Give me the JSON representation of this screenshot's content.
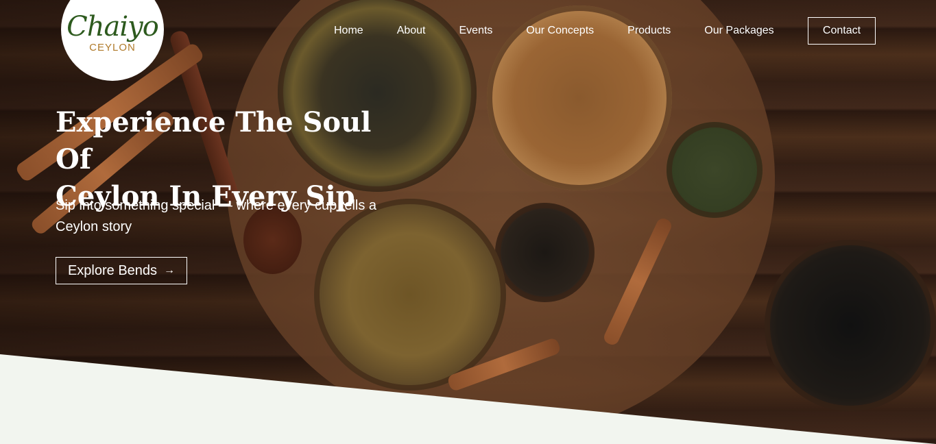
{
  "brand": {
    "logo_script": "Chaiyo",
    "logo_sub": "CEYLON"
  },
  "nav": {
    "items": [
      {
        "label": "Home"
      },
      {
        "label": "About"
      },
      {
        "label": "Events"
      },
      {
        "label": "Our Concepts"
      },
      {
        "label": "Products"
      },
      {
        "label": "Our Packages"
      }
    ],
    "contact_label": "Contact"
  },
  "hero": {
    "title_line1": "Experience The Soul Of",
    "title_line2": "Ceylon In Every Sip",
    "subtitle": "Sip into something special — where every cup tells a Ceylon story",
    "cta_label": "Explore Bends",
    "cta_icon": "arrow-right-icon"
  },
  "colors": {
    "brand_green": "#2d5a1e",
    "brand_gold": "#b07a2a",
    "page_bg": "#f2f5ef"
  }
}
